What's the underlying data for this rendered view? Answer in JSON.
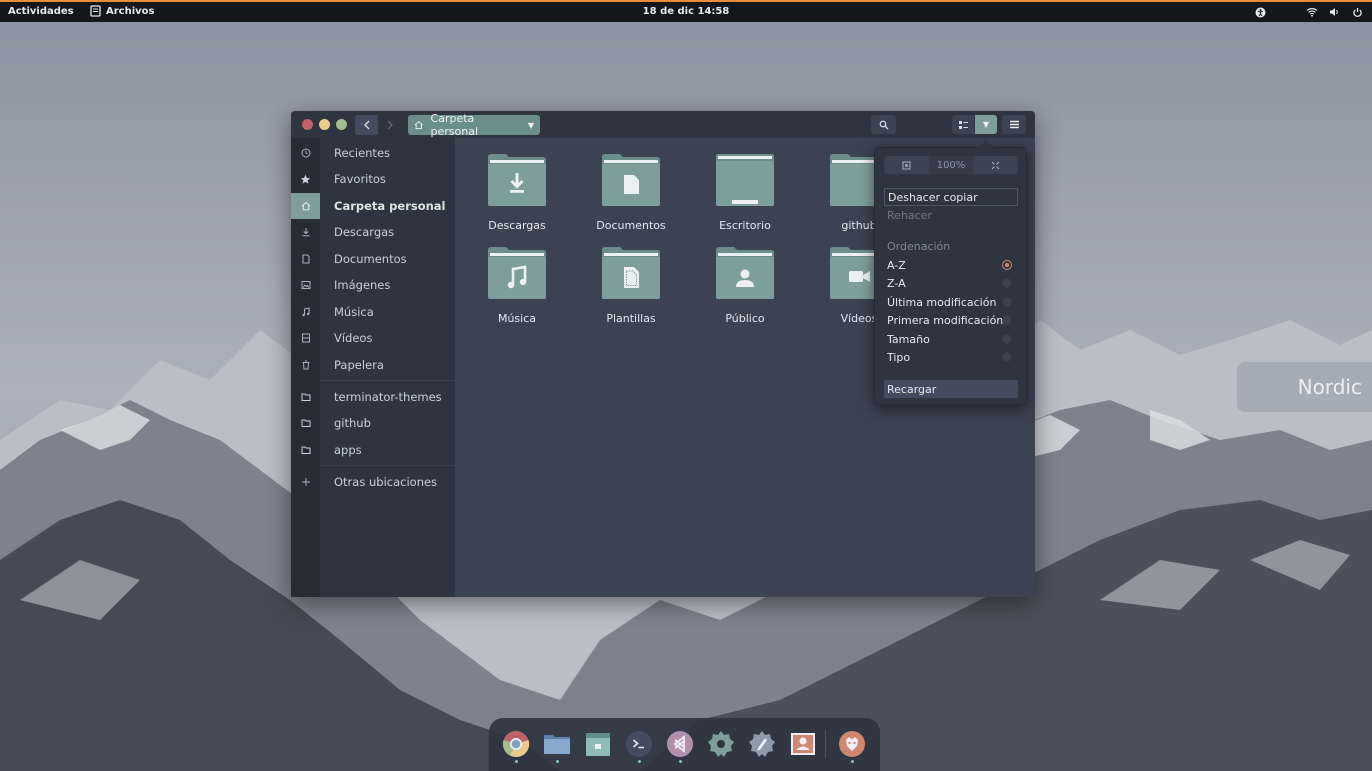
{
  "topbar": {
    "activities": "Actividades",
    "app_name": "Archivos",
    "clock": "18 de dic  14:58",
    "tray_icons": [
      "accessibility-icon",
      "wifi-icon",
      "volume-icon",
      "power-icon"
    ],
    "accent": "#e88a3a"
  },
  "desktop": {
    "theme_label": "Nordic"
  },
  "window": {
    "path": "Carpeta personal",
    "sidebar": {
      "items": [
        {
          "label": "Recientes",
          "icon": "clock-icon"
        },
        {
          "label": "Favoritos",
          "icon": "star-icon"
        },
        {
          "label": "Carpeta personal",
          "icon": "home-icon",
          "active": true
        },
        {
          "label": "Descargas",
          "icon": "download-icon"
        },
        {
          "label": "Documentos",
          "icon": "document-icon"
        },
        {
          "label": "Imágenes",
          "icon": "image-icon"
        },
        {
          "label": "Música",
          "icon": "music-icon"
        },
        {
          "label": "Vídeos",
          "icon": "video-icon"
        },
        {
          "label": "Papelera",
          "icon": "trash-icon"
        }
      ],
      "bookmarks": [
        {
          "label": "terminator-themes",
          "icon": "folder-icon"
        },
        {
          "label": "github",
          "icon": "folder-icon"
        },
        {
          "label": "apps",
          "icon": "folder-icon"
        }
      ],
      "other": {
        "label": "Otras ubicaciones",
        "icon": "plus-icon"
      }
    },
    "files": [
      {
        "label": "Descargas",
        "emblem": "download"
      },
      {
        "label": "Documentos",
        "emblem": "document"
      },
      {
        "label": "Escritorio",
        "emblem": "desktop"
      },
      {
        "label": "github",
        "emblem": "none"
      },
      {
        "label": "Música",
        "emblem": "music"
      },
      {
        "label": "Plantillas",
        "emblem": "template"
      },
      {
        "label": "Público",
        "emblem": "public"
      },
      {
        "label": "Vídeos",
        "emblem": "video"
      }
    ],
    "colors": {
      "folder": "#7d9e9c",
      "folder_dark": "#6b8e8c",
      "accent": "#7d9e9c"
    }
  },
  "popover": {
    "zoom_level": "100%",
    "undo": "Deshacer copiar",
    "redo": "Rehacer",
    "sort_heading": "Ordenación",
    "sort_options": [
      {
        "label": "A-Z",
        "checked": true
      },
      {
        "label": "Z-A",
        "checked": false
      },
      {
        "label": "Última modificación",
        "checked": false
      },
      {
        "label": "Primera modificación",
        "checked": false
      },
      {
        "label": "Tamaño",
        "checked": false
      },
      {
        "label": "Tipo",
        "checked": false
      }
    ],
    "reload": "Recargar"
  },
  "dock": {
    "apps": [
      "chrome-icon",
      "files-icon",
      "calendar-icon",
      "terminal-icon",
      "vscode-icon",
      "settings-icon",
      "gedit-icon",
      "image-viewer-icon",
      "firefox-icon"
    ]
  }
}
